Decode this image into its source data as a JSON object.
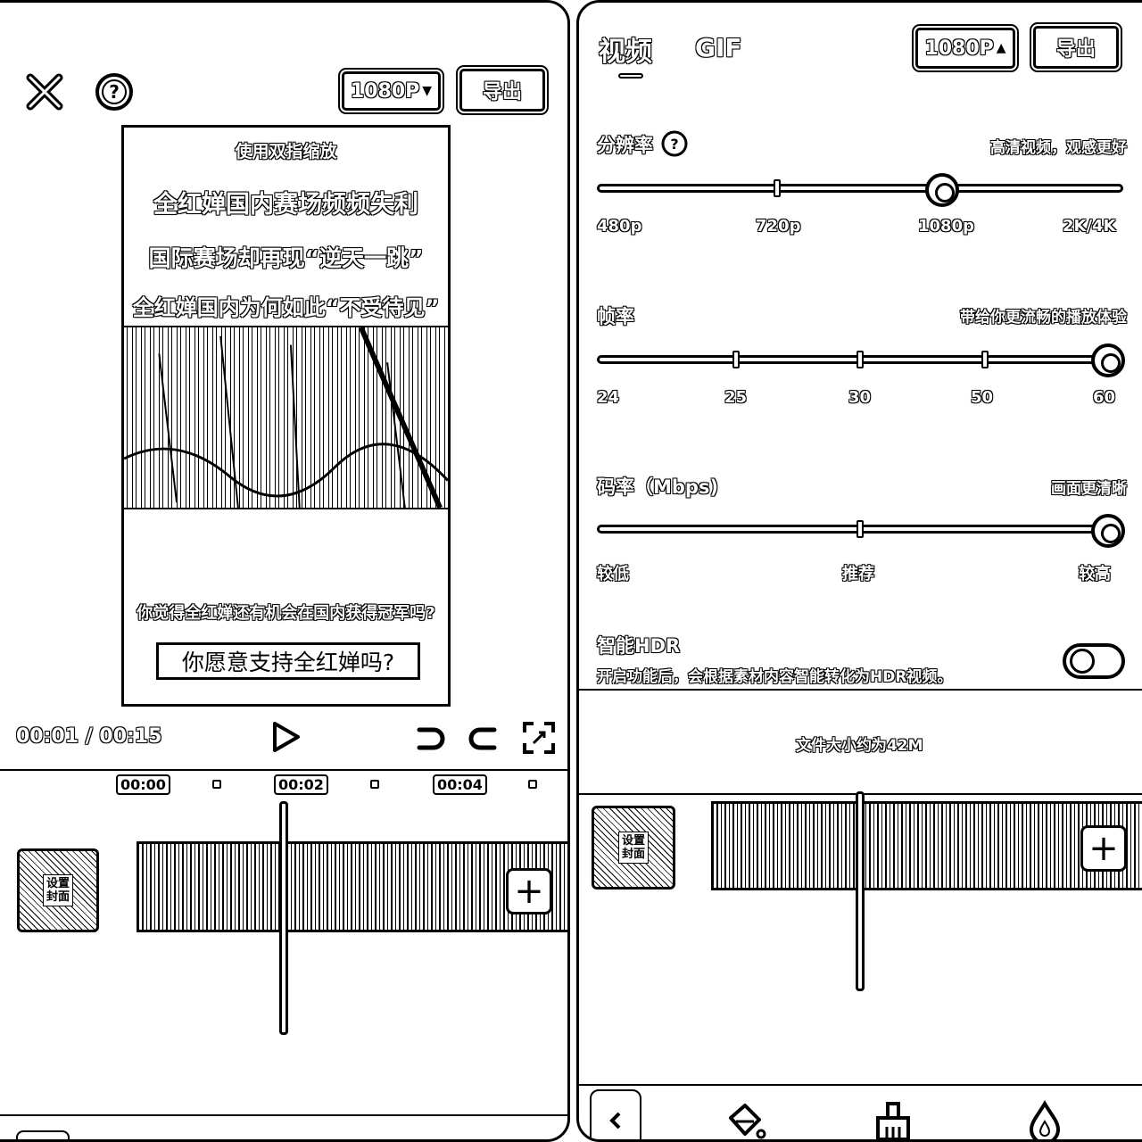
{
  "editor": {
    "resolution_button": "1080P",
    "export_button": "导出",
    "preview": {
      "hint": "使用双指缩放",
      "headline_1": "全红婵国内赛场频频失利",
      "headline_2": "国际赛场却再现“逆天一跳”",
      "headline_3": "全红婵国内为何如此“不受待见”",
      "question": "你觉得全红婵还有机会在国内获得冠军吗?",
      "vote": "你愿意支持全红婵吗?"
    },
    "timecode": "00:01 / 00:15",
    "timeline": {
      "ruler": [
        "00:00",
        "00:02",
        "00:04"
      ],
      "cover_label": "设置封面"
    }
  },
  "export_panel": {
    "tabs": {
      "video": "视频",
      "gif": "GIF"
    },
    "resolution_button": "1080P",
    "export_button": "导出",
    "resolution": {
      "title": "分辨率",
      "hint": "高清视频，观感更好",
      "options": [
        "480p",
        "720p",
        "1080p",
        "2K/4K"
      ],
      "selected": "1080p"
    },
    "frame_rate": {
      "title": "帧率",
      "hint": "带给你更流畅的播放体验",
      "options": [
        "24",
        "25",
        "30",
        "50",
        "60"
      ],
      "selected": "60"
    },
    "bitrate": {
      "title": "码率（Mbps)",
      "hint": "画面更清晰",
      "options": [
        "较低",
        "推荐",
        "较高"
      ],
      "selected": "较高"
    },
    "hdr": {
      "title": "智能HDR",
      "description": "开启功能后，会根据素材内容智能转化为HDR视频。",
      "enabled": false
    },
    "file_size": "文件大小约为42M",
    "cover_label": "设置封面"
  }
}
